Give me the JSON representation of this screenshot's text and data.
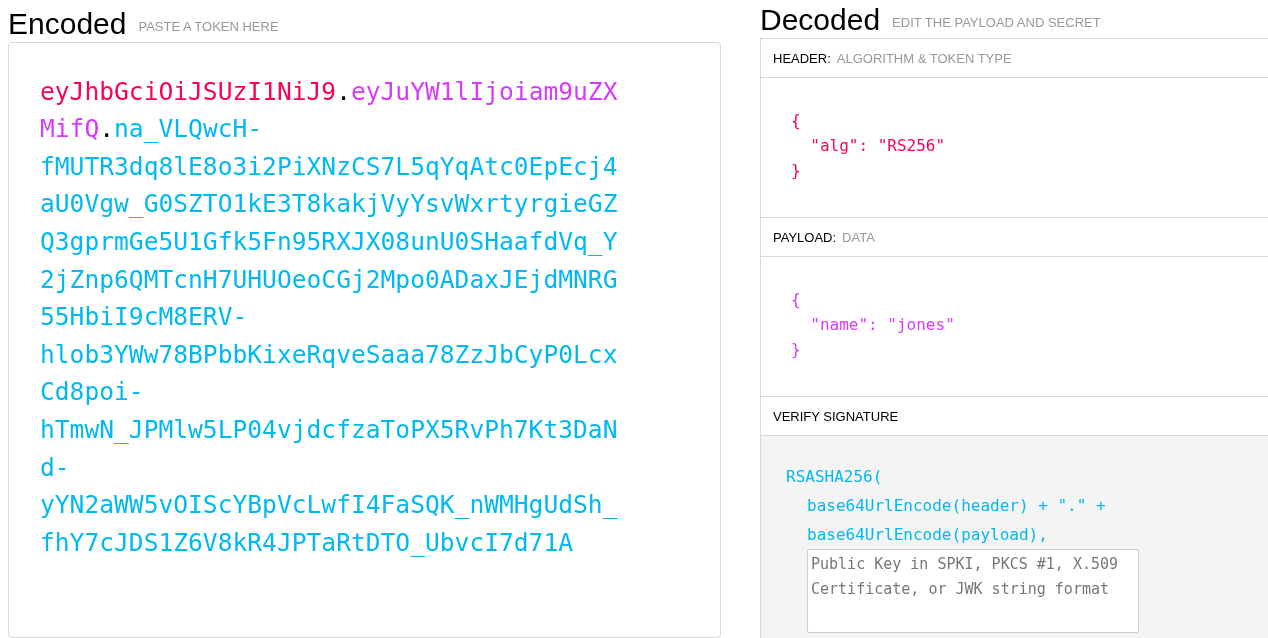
{
  "encoded": {
    "title": "Encoded",
    "subtitle": "PASTE A TOKEN HERE",
    "token_parts": [
      {
        "kind": "header",
        "text": "eyJhbGciOiJSUzI1NiJ9"
      },
      {
        "kind": "dot",
        "text": "."
      },
      {
        "kind": "payload",
        "text": "eyJuYW1lIjoiam9uZXMifQ"
      },
      {
        "kind": "dot",
        "text": "."
      },
      {
        "kind": "signature",
        "text": "na_VLQwcH-fMUTR3dq8lE8o3i2PiXNzCS7L5qYqAtc0EpEcj4aU0Vgw_G0SZTO1kE3T8kakjVyYsvWxrtyrgieGZQ3gprmGe5U1Gfk5Fn95RXJX08unU0SHaafdVq_Y2jZnp6QMTcnH7UHUOeoCGj2Mpo0ADaxJEjdMNRG55HbiI9cM8ERV-hlob3YWw78BPbbKixeRqveSaaa78ZzJbCyP0LcxCd8poi-hTmwN_JPMlw5LP04vjdcfzaToPX5RvPh7Kt3DaNd-yYN2aWW5vOIScYBpVcLwfI4FaSQK_nWMHgUdSh_fhY7cJDS1Z6V8kR4JPTaRtDTO_UbvcI7d71A"
      }
    ]
  },
  "decoded": {
    "title": "Decoded",
    "subtitle": "EDIT THE PAYLOAD AND SECRET",
    "sections": [
      {
        "kind": "header",
        "label": "HEADER:",
        "sublabel": "ALGORITHM & TOKEN TYPE",
        "json": "{\n  \"alg\": \"RS256\"\n}"
      },
      {
        "kind": "payload",
        "label": "PAYLOAD:",
        "sublabel": "DATA",
        "json": "{\n  \"name\": \"jones\"\n}"
      }
    ],
    "verify": {
      "label": "VERIFY SIGNATURE",
      "function": "RSASHA256(",
      "args": [
        "base64UrlEncode(header) + \".\" +",
        "base64UrlEncode(payload),"
      ],
      "key_placeholder": "Public Key in SPKI, PKCS #1, X.509 Certificate, or JWK string format"
    }
  }
}
